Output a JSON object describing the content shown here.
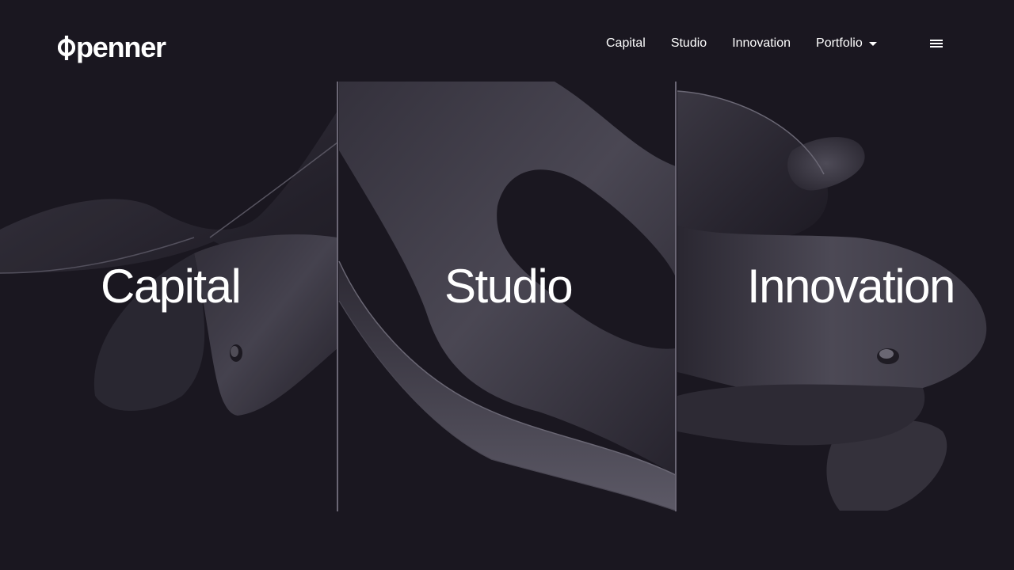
{
  "brand": {
    "logo_text": "penner",
    "logo_icon": "phi-mark-icon"
  },
  "nav": {
    "items": [
      {
        "label": "Capital"
      },
      {
        "label": "Studio"
      },
      {
        "label": "Innovation"
      },
      {
        "label": "Portfolio",
        "has_dropdown": true
      }
    ],
    "menu_icon": "hamburger-menu-icon"
  },
  "panels": [
    {
      "title": "Capital"
    },
    {
      "title": "Studio"
    },
    {
      "title": "Innovation"
    }
  ],
  "colors": {
    "background": "#1a1720",
    "text": "#ffffff",
    "divider": "#6a6674",
    "shape": "#3a3742"
  }
}
